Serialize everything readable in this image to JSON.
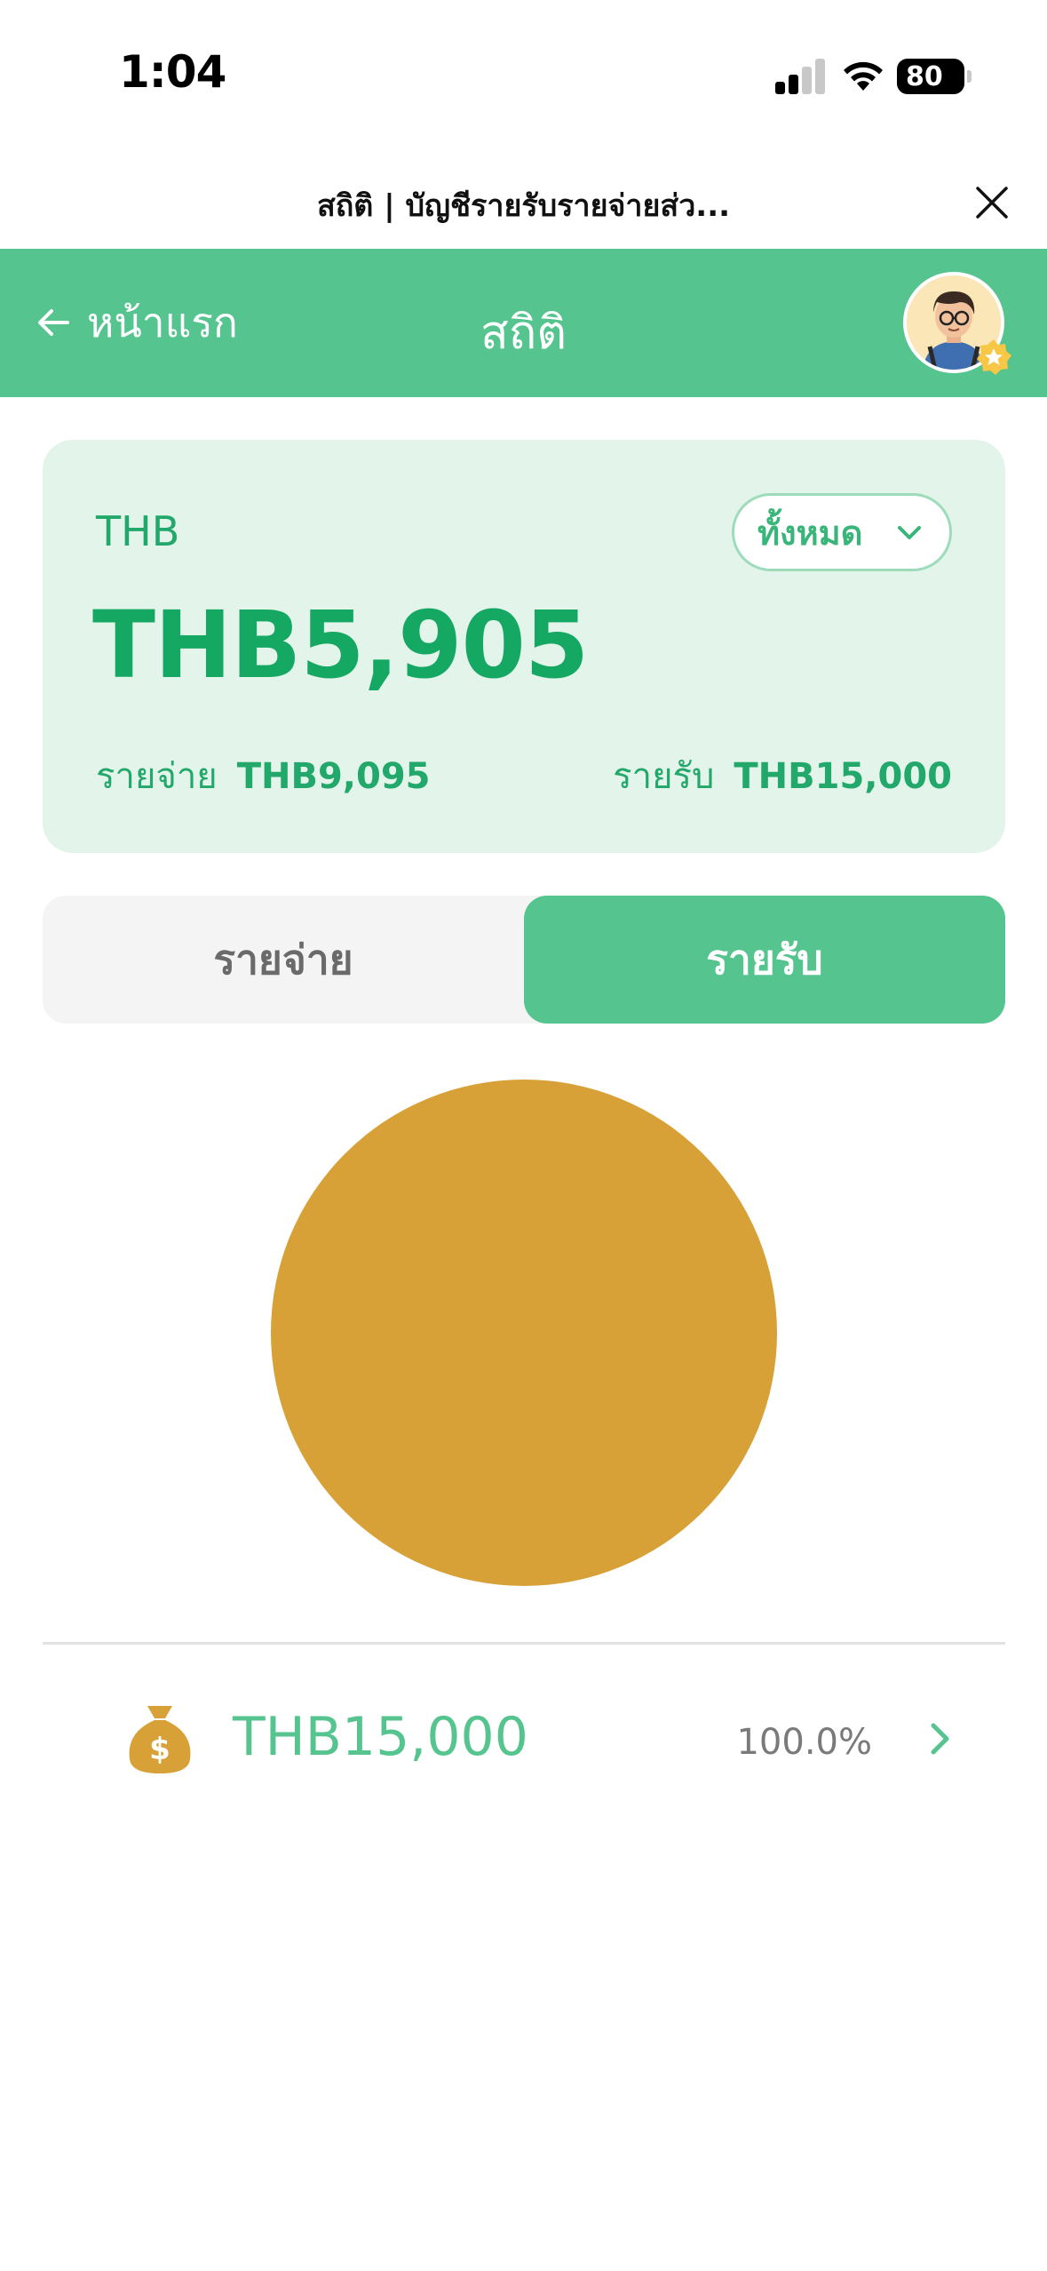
{
  "status_bar": {
    "time": "1:04",
    "battery": "80"
  },
  "web_view": {
    "title": "สถิติ | บัญชีรายรับรายจ่ายส่ว..."
  },
  "header": {
    "back_label": "หน้าแรก",
    "title": "สถิติ"
  },
  "summary": {
    "currency": "THB",
    "filter_label": "ทั้งหมด",
    "balance": "THB5,905",
    "expense_label": "รายจ่าย",
    "expense_value": "THB9,095",
    "income_label": "รายรับ",
    "income_value": "THB15,000"
  },
  "tabs": [
    {
      "label": "รายจ่าย",
      "active": false
    },
    {
      "label": "รายรับ",
      "active": true
    }
  ],
  "colors": {
    "accent": "#55c48f",
    "accent_dark": "#14a862",
    "card_bg": "#e3f4ea",
    "category_gold": "#d8a137"
  },
  "chart_data": {
    "type": "pie",
    "slices": [
      {
        "value": 15000,
        "percent": 100.0,
        "color": "#d8a137"
      }
    ]
  },
  "categories": [
    {
      "icon": "money-bag-icon",
      "amount": "THB15,000",
      "percent": "100.0%",
      "color": "#d8a137"
    }
  ]
}
